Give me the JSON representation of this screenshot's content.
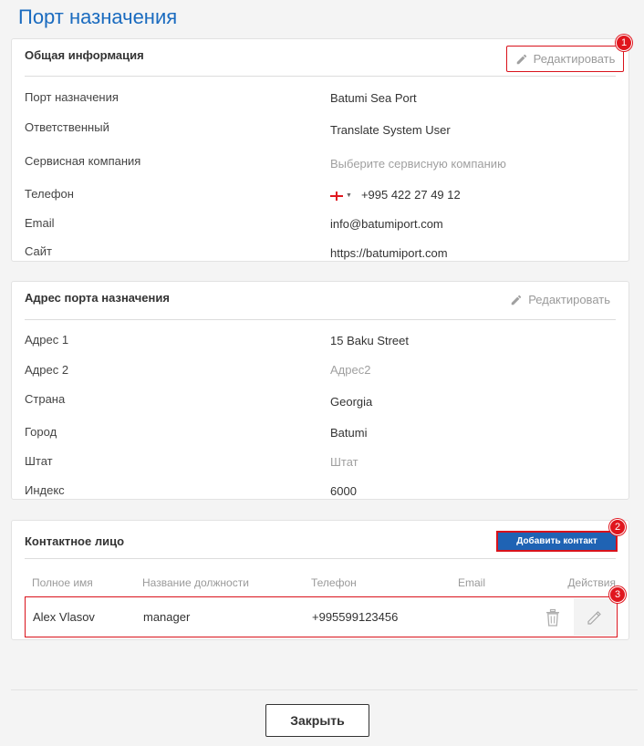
{
  "page_title": "Порт назначения",
  "general": {
    "title": "Общая информация",
    "edit_label": "Редактировать",
    "badge": "1",
    "rows": [
      {
        "label": "Порт назначения",
        "value": "Batumi Sea Port"
      },
      {
        "label": "Ответственный",
        "value": "Translate System User"
      },
      {
        "label": "Сервисная компания",
        "value": "Выберите сервисную компанию"
      },
      {
        "label": "Телефон",
        "value": "+995 422 27 49 12"
      },
      {
        "label": "Email",
        "value": "info@batumiport.com"
      },
      {
        "label": "Сайт",
        "value": "https://batumiport.com"
      }
    ]
  },
  "address": {
    "title": "Адрес порта назначения",
    "edit_label": "Редактировать",
    "rows": [
      {
        "label": "Адрес 1",
        "value": "15 Baku Street"
      },
      {
        "label": "Адрес 2",
        "value": "Адрес2"
      },
      {
        "label": "Страна",
        "value": "Georgia"
      },
      {
        "label": "Город",
        "value": "Batumi"
      },
      {
        "label": "Штат",
        "value": "Штат"
      },
      {
        "label": "Индекс",
        "value": "6000"
      }
    ]
  },
  "contacts": {
    "title": "Контактное лицо",
    "add_label": "Добавить контакт",
    "badge_add": "2",
    "badge_row": "3",
    "columns": [
      "Полное имя",
      "Название должности",
      "Телефон",
      "Email",
      "Действия"
    ],
    "rows": [
      {
        "name": "Alex Vlasov",
        "position": "manager",
        "phone": "+995599123456",
        "email": ""
      }
    ]
  },
  "footer": {
    "close_label": "Закрыть"
  },
  "colors": {
    "accent": "#1a6bbf",
    "primary_button": "#1f63b4",
    "annotation": "#e0161e"
  }
}
